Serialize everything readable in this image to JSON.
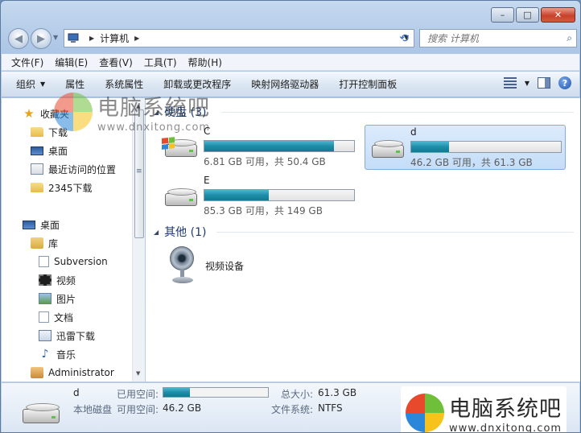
{
  "window": {
    "caption_buttons": {
      "minimize": "–",
      "maximize": "□",
      "close": "✕"
    }
  },
  "address_bar": {
    "crumbs": [
      "计算机"
    ],
    "search_placeholder": "搜索 计算机"
  },
  "menu": [
    "文件(F)",
    "编辑(E)",
    "查看(V)",
    "工具(T)",
    "帮助(H)"
  ],
  "toolbar": {
    "organize": "组织",
    "properties": "属性",
    "system_properties": "系统属性",
    "uninstall": "卸载或更改程序",
    "map_drive": "映射网络驱动器",
    "control_panel": "打开控制面板"
  },
  "nav": {
    "favorites": "收藏夹",
    "downloads": "下载",
    "desktop_fav": "桌面",
    "recent": "最近访问的位置",
    "download2345": "2345下载",
    "desktop": "桌面",
    "libraries": "库",
    "subversion": "Subversion",
    "videos": "视频",
    "pictures": "图片",
    "documents": "文档",
    "thunder": "迅雷下载",
    "music": "音乐",
    "admin": "Administrator"
  },
  "groups": {
    "hard_disks": "硬盘 (3)",
    "other": "其他 (1)"
  },
  "drives": [
    {
      "name": "C",
      "free_text": "6.81 GB 可用，共 50.4 GB",
      "used_fraction": 0.865
    },
    {
      "name": "d",
      "free_text": "46.2 GB 可用，共 61.3 GB",
      "used_fraction": 0.25
    },
    {
      "name": "E",
      "free_text": "85.3 GB 可用，共 149 GB",
      "used_fraction": 0.43
    }
  ],
  "other_devices": [
    {
      "name": "视频设备"
    }
  ],
  "details": {
    "name": "d",
    "type": "本地磁盘",
    "used_label": "已用空间:",
    "free_label": "可用空间:",
    "free_value": "46.2 GB",
    "total_label": "总大小:",
    "total_value": "61.3 GB",
    "fs_label": "文件系统:",
    "fs_value": "NTFS",
    "used_fraction": 0.25
  },
  "watermark": {
    "title": "电脑系统吧",
    "url": "www.dnxitong.com"
  },
  "colors": {
    "bar_fill": "#1d8ea8",
    "selection": "#c4ddf8",
    "header_text": "#1e3a6e"
  }
}
